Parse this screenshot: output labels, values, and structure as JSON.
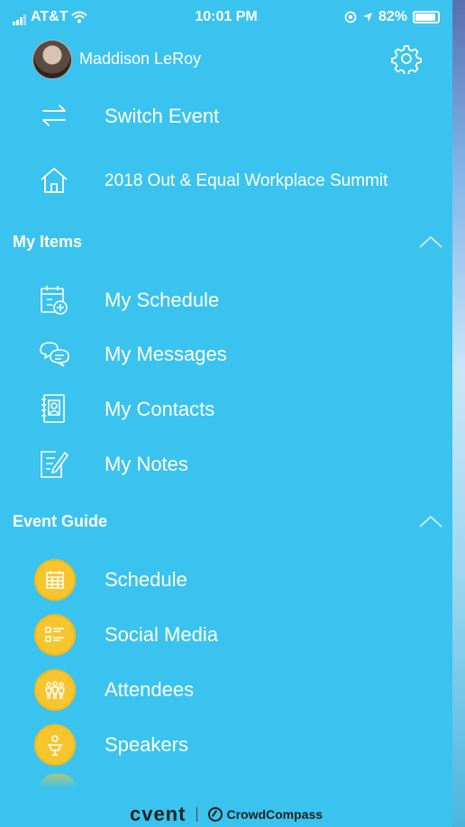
{
  "status_bar": {
    "carrier": "AT&T",
    "time": "10:01 PM",
    "battery_percent": "82%"
  },
  "header": {
    "user_name": "Maddison LeRoy",
    "avatar_icon": "user-photo",
    "settings_icon": "gear-icon"
  },
  "top_items": [
    {
      "label": "Switch Event",
      "icon": "switch-arrows-icon"
    },
    {
      "label": "2018 Out & Equal Workplace Summit",
      "icon": "home-icon"
    }
  ],
  "my_items": {
    "title": "My Items",
    "items": [
      {
        "label": "My Schedule",
        "icon": "calendar-add-icon"
      },
      {
        "label": "My Messages",
        "icon": "chat-bubbles-icon"
      },
      {
        "label": "My Contacts",
        "icon": "contact-book-icon"
      },
      {
        "label": "My Notes",
        "icon": "note-edit-icon"
      }
    ]
  },
  "event_guide": {
    "title": "Event Guide",
    "items": [
      {
        "label": "Schedule",
        "icon": "calendar-grid-icon"
      },
      {
        "label": "Social Media",
        "icon": "list-icon"
      },
      {
        "label": "Attendees",
        "icon": "people-icon"
      },
      {
        "label": "Speakers",
        "icon": "speaker-podium-icon"
      }
    ]
  },
  "footer": {
    "brand": "cvent",
    "partner": "CrowdCompass"
  },
  "colors": {
    "background": "#3ac3ef",
    "guide_icon_bg": "#f7c62f",
    "text": "#ffffff"
  }
}
